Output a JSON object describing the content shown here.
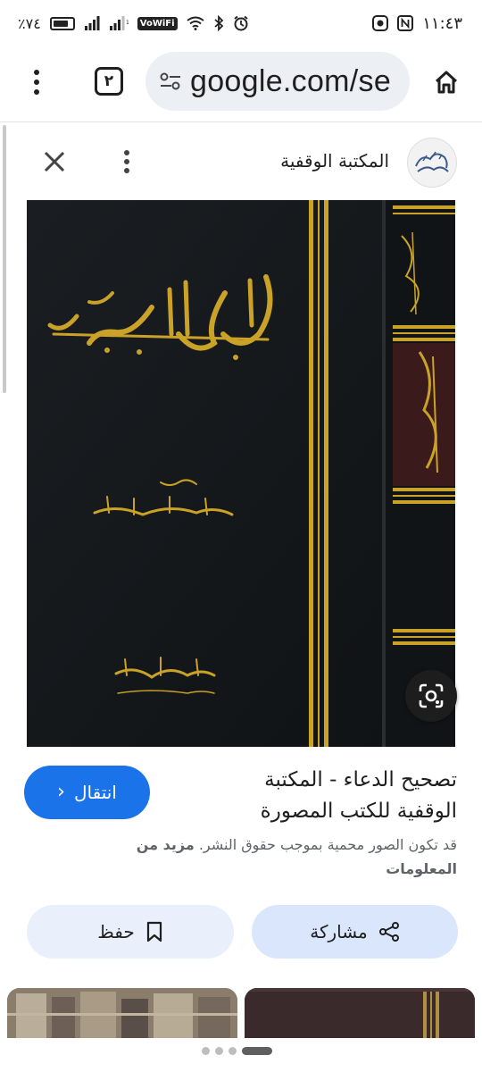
{
  "status_bar": {
    "battery_text": "٪٧٤",
    "vowifi_label": "VoWiFi",
    "time": "١١:٤٣"
  },
  "browser": {
    "tab_count": "٢",
    "url": "google.com/se"
  },
  "source": {
    "name": "المكتبة الوقفية"
  },
  "result": {
    "title": "تصحيح الدعاء - المكتبة الوقفية للكتب المصورة",
    "visit_label": "انتقال",
    "disclaimer": "قد تكون الصور محمية بموجب حقوق النشر.",
    "more_info": "مزيد من المعلومات"
  },
  "actions": {
    "share_label": "مشاركة",
    "save_label": "حفظ"
  },
  "colors": {
    "accent": "#1a73e8",
    "book_cover": "#141719",
    "gold": "#c9a227"
  }
}
